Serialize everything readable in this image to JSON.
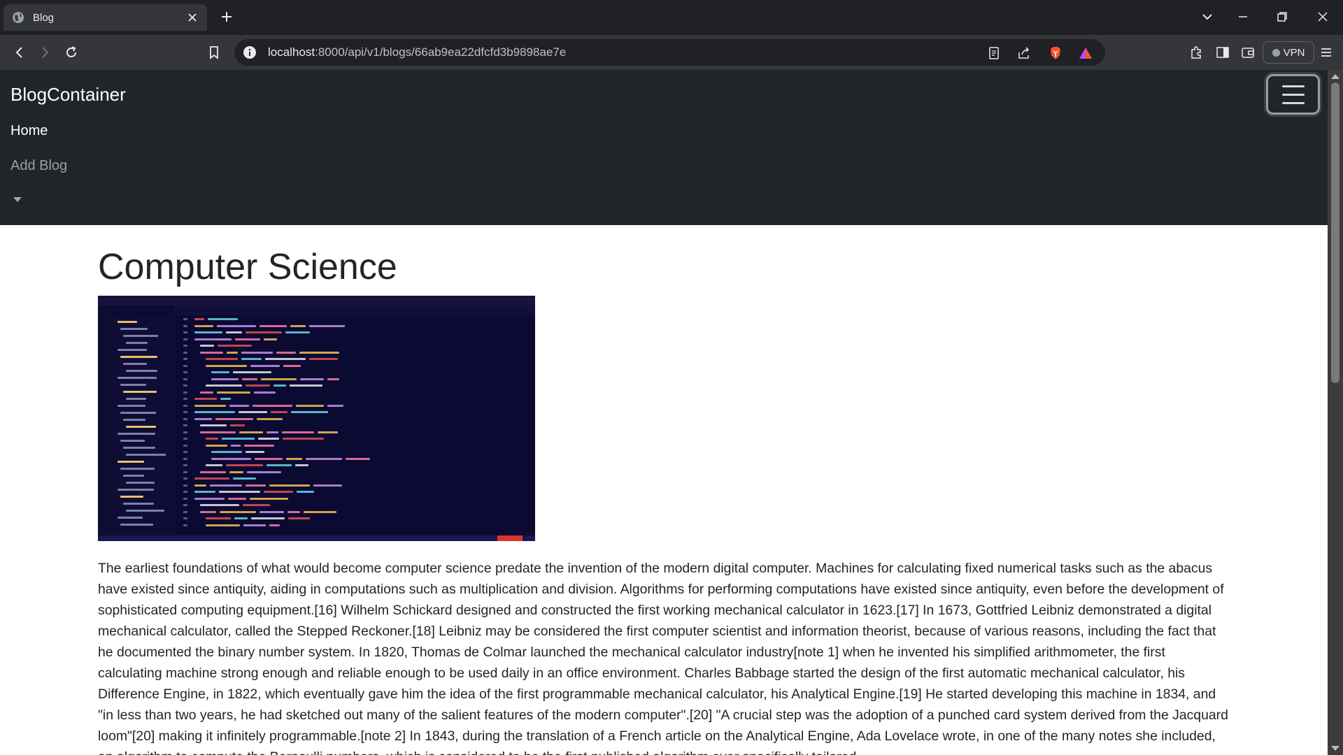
{
  "browser": {
    "tab_title": "Blog",
    "url_host": "localhost",
    "url_rest": ":8000/api/v1/blogs/66ab9ea22dfcfd3b9898ae7e",
    "vpn_label": "VPN",
    "accent": "#202124"
  },
  "navbar": {
    "brand": "BlogContainer",
    "items": [
      {
        "label": "Home"
      },
      {
        "label": "Add Blog"
      }
    ]
  },
  "blog": {
    "title": "Computer Science",
    "image_alt_icon": "code-editor-screenshot",
    "body": "The earliest foundations of what would become computer science predate the invention of the modern digital computer. Machines for calculating fixed numerical tasks such as the abacus have existed since antiquity, aiding in computations such as multiplication and division. Algorithms for performing computations have existed since antiquity, even before the development of sophisticated computing equipment.[16] Wilhelm Schickard designed and constructed the first working mechanical calculator in 1623.[17] In 1673, Gottfried Leibniz demonstrated a digital mechanical calculator, called the Stepped Reckoner.[18] Leibniz may be considered the first computer scientist and information theorist, because of various reasons, including the fact that he documented the binary number system. In 1820, Thomas de Colmar launched the mechanical calculator industry[note 1] when he invented his simplified arithmometer, the first calculating machine strong enough and reliable enough to be used daily in an office environment. Charles Babbage started the design of the first automatic mechanical calculator, his Difference Engine, in 1822, which eventually gave him the idea of the first programmable mechanical calculator, his Analytical Engine.[19] He started developing this machine in 1834, and \"in less than two years, he had sketched out many of the salient features of the modern computer\".[20] \"A crucial step was the adoption of a punched card system derived from the Jacquard loom\"[20] making it infinitely programmable.[note 2] In 1843, during the translation of a French article on the Analytical Engine, Ada Lovelace wrote, in one of the many notes she included, an algorithm to compute the Bernoulli numbers, which is considered to be the first published algorithm ever specifically tailored"
  }
}
